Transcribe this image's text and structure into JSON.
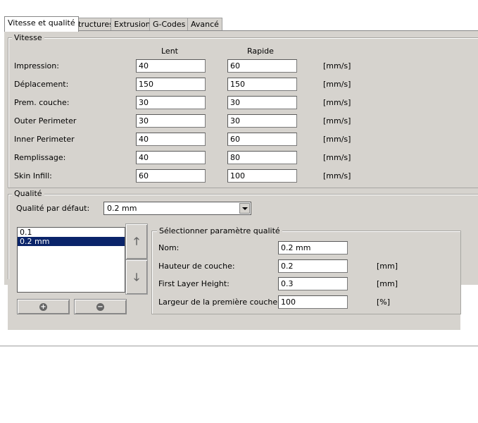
{
  "tabs": [
    {
      "label": "Vitesse et qualité",
      "active": true
    },
    {
      "label": "Structures"
    },
    {
      "label": "Extrusion"
    },
    {
      "label": "G-Codes"
    },
    {
      "label": "Avancé"
    }
  ],
  "vitesse": {
    "group_label": "Vitesse",
    "col_lent": "Lent",
    "col_rapide": "Rapide",
    "unit": "[mm/s]",
    "rows": [
      {
        "label": "Impression:",
        "lent": "40",
        "rapide": "60"
      },
      {
        "label": "Déplacement:",
        "lent": "150",
        "rapide": "150"
      },
      {
        "label": "Prem. couche:",
        "lent": "30",
        "rapide": "30"
      },
      {
        "label": "Outer Perimeter",
        "lent": "30",
        "rapide": "30"
      },
      {
        "label": "Inner Perimeter",
        "lent": "40",
        "rapide": "60"
      },
      {
        "label": "Remplissage:",
        "lent": "40",
        "rapide": "80"
      },
      {
        "label": "Skin Infill:",
        "lent": "60",
        "rapide": "100"
      }
    ]
  },
  "qualite": {
    "group_label": "Qualité",
    "default_label": "Qualité par défaut:",
    "default_value": "0.2 mm",
    "list": [
      "0.1",
      "0.2 mm"
    ],
    "selected_index": 1,
    "up_icon": "arrow-up-icon",
    "down_icon": "arrow-down-icon",
    "add_icon": "plus-circle-icon",
    "remove_icon": "minus-circle-icon",
    "param": {
      "group_label": "Sélectionner paramètre qualité",
      "rows": [
        {
          "label": "Nom:",
          "value": "0.2 mm",
          "unit": ""
        },
        {
          "label": "Hauteur de couche:",
          "value": "0.2",
          "unit": "[mm]"
        },
        {
          "label": "First Layer Height:",
          "value": "0.3",
          "unit": "[mm]"
        },
        {
          "label": "Largeur de la première couche:",
          "value": "100",
          "unit": "[%]"
        }
      ]
    }
  }
}
